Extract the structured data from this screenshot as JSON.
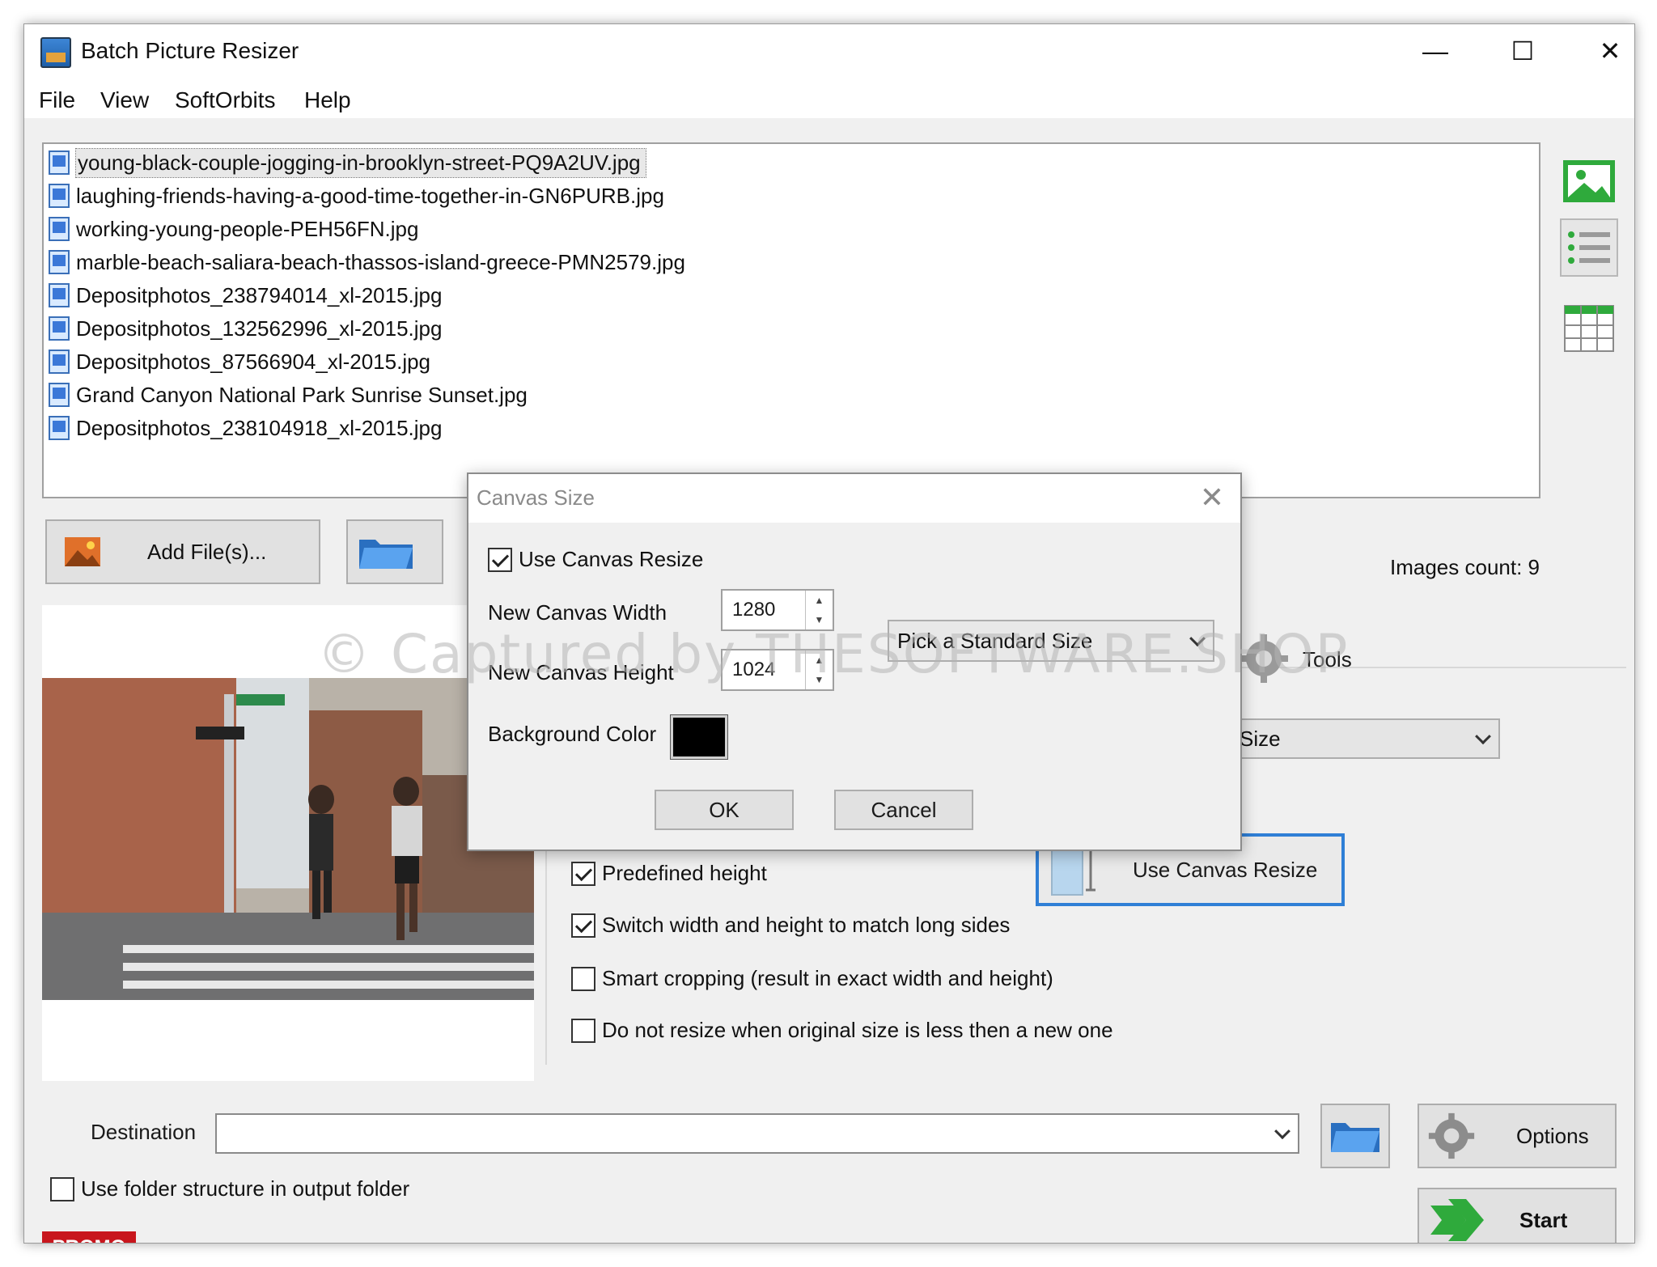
{
  "window": {
    "title": "Batch Picture Resizer"
  },
  "window_controls": {
    "minimize": "—",
    "maximize": "☐",
    "close": "✕"
  },
  "menu": [
    "File",
    "View",
    "SoftOrbits",
    "Help"
  ],
  "files": [
    "young-black-couple-jogging-in-brooklyn-street-PQ9A2UV.jpg",
    "laughing-friends-having-a-good-time-together-in-GN6PURB.jpg",
    "working-young-people-PEH56FN.jpg",
    "marble-beach-saliara-beach-thassos-island-greece-PMN2579.jpg",
    "Depositphotos_238794014_xl-2015.jpg",
    "Depositphotos_132562996_xl-2015.jpg",
    "Depositphotos_87566904_xl-2015.jpg",
    "Grand Canyon National Park Sunrise Sunset.jpg",
    "Depositphotos_238104918_xl-2015.jpg"
  ],
  "selected_file_index": 0,
  "buttons": {
    "add_files": "Add File(s)...",
    "tools": "Tools",
    "options": "Options",
    "start": "Start",
    "canvas_resize": "Use Canvas Resize"
  },
  "images_count": "Images count: 9",
  "resize_select": {
    "partial_value": "Size"
  },
  "options": {
    "predefined_height": {
      "label": "Predefined height",
      "checked": true
    },
    "switch_sides": {
      "label": "Switch width and height to match long sides",
      "checked": true
    },
    "smart_crop": {
      "label": "Smart cropping (result in exact width and height)",
      "checked": false
    },
    "no_upscale": {
      "label": "Do not resize when original size is less then a new one",
      "checked": false
    }
  },
  "destination": {
    "label": "Destination",
    "value": ""
  },
  "folder_structure": {
    "label": "Use folder structure in output folder",
    "checked": false
  },
  "promo": "PROMO",
  "dialog": {
    "title": "Canvas Size",
    "close": "✕",
    "use_canvas_resize": {
      "label": "Use Canvas Resize",
      "checked": true
    },
    "width_label": "New Canvas Width",
    "width_value": "1280",
    "height_label": "New Canvas Height",
    "height_value": "1024",
    "standard_size": "Pick a Standard Size",
    "bg_color_label": "Background Color",
    "bg_color": "#000000",
    "ok": "OK",
    "cancel": "Cancel"
  },
  "watermark": "© Captured by THESOFTWARE.SHOP",
  "colors": {
    "accent": "#2f7fd6",
    "promo": "#c8161d",
    "start_arrow": "#2faa3c"
  }
}
